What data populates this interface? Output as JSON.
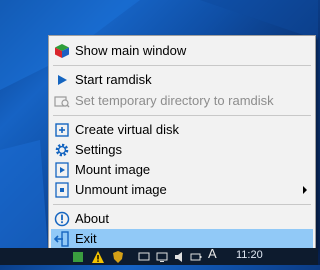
{
  "menu": {
    "items": [
      {
        "label": "Show main window",
        "icon": "app-cube-icon",
        "enabled": true
      },
      {
        "label": "Start ramdisk",
        "icon": "play-icon",
        "enabled": true
      },
      {
        "label": "Set temporary directory to ramdisk",
        "icon": "folder-search-icon",
        "enabled": false
      },
      {
        "label": "Create virtual disk",
        "icon": "plus-box-icon",
        "enabled": true
      },
      {
        "label": "Settings",
        "icon": "gear-icon",
        "enabled": true
      },
      {
        "label": "Mount image",
        "icon": "mount-play-icon",
        "enabled": true
      },
      {
        "label": "Unmount image",
        "icon": "unmount-icon",
        "enabled": true,
        "submenu": true
      },
      {
        "label": "About",
        "icon": "info-icon",
        "enabled": true
      },
      {
        "label": "Exit",
        "icon": "exit-door-icon",
        "enabled": true,
        "selected": true
      }
    ]
  },
  "taskbar": {
    "language": "A",
    "clock": "11:20"
  },
  "colors": {
    "accent_blue": "#1565c0",
    "selected_bg": "#91c9f7",
    "menu_bg": "#f2f2f2"
  }
}
